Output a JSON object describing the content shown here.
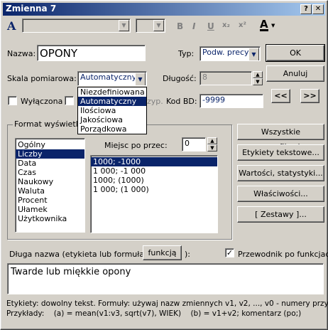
{
  "window": {
    "title": "Zmienna 7",
    "help_btn": "?",
    "close_btn": "✕"
  },
  "toolbar": {
    "font_icon": "A",
    "bold": "B",
    "italic": "I",
    "underline": "U",
    "subscript": "x₂",
    "superscript": "x²",
    "color_icon": "A"
  },
  "form": {
    "name_label": "Nazwa:",
    "name_value": "OPONY",
    "type_label": "Typ:",
    "type_value": "Podw. precyzj",
    "ok": "OK",
    "scale_label": "Skala pomiarowa:",
    "scale_value": "Automatyczny",
    "length_label": "Długość:",
    "length_value": "8",
    "cancel": "Anuluj",
    "disabled_label": "Wyłączona",
    "bd_code_label": "Kod BD:",
    "bd_code_value": "-9999",
    "bd_hidden_suffix": "zyp.",
    "prev": "<<",
    "next": ">>"
  },
  "scale_options": [
    "Niezdefiniowana",
    "Automatyczny",
    "Ilościowa",
    "Jakościowa",
    "Porządkowa"
  ],
  "format": {
    "group_label": "Format wyświetlani",
    "types": [
      "Ogólny",
      "Liczby",
      "Data",
      "Czas",
      "Naukowy",
      "Waluta",
      "Procent",
      "Ułamek",
      "Użytkownika"
    ],
    "decimals_label": "Miejsc po przec:",
    "decimals_value": "0",
    "patterns": [
      "1000; -1000",
      "1 000; -1 000",
      "1000; (1000)",
      "1 000; (1 000)"
    ]
  },
  "side_buttons": {
    "all_specs": "Wszystkie specyfikacje",
    "text_labels": "Etykiety tekstowe...",
    "values_stats": "Wartości, statystyki...",
    "properties": "Właściwości...",
    "sets": "[ Zestawy ]..."
  },
  "long_name": {
    "label": "Długa nazwa (etykieta lub formuła z",
    "func_btn": "funkcją",
    "label_end": "):",
    "wizard_label": "Przewodnik po funkcjach",
    "wizard_checked": "✓",
    "value": "Twarde lub miękkie opony"
  },
  "help": {
    "line1": "Etykiety: dowolny tekst. Formuły: używaj nazw zmiennych v1, v2, ..., v0 - numery przyp.",
    "line2": "Przykłady:    (a) = mean(v1:v3, sqrt(v7), WIEK)    (b) = v1+v2; komentarz (po;)"
  }
}
